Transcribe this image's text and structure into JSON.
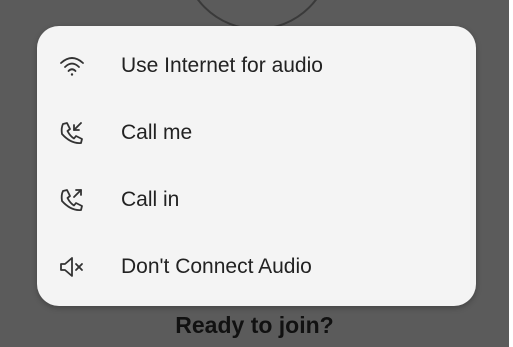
{
  "audio_menu": {
    "options": [
      {
        "label": "Use Internet for audio",
        "icon": "wifi-icon"
      },
      {
        "label": "Call me",
        "icon": "phone-incoming-icon"
      },
      {
        "label": "Call in",
        "icon": "phone-outgoing-icon"
      },
      {
        "label": "Don't Connect Audio",
        "icon": "speaker-muted-icon"
      }
    ]
  },
  "footer": {
    "ready_text": "Ready to join?"
  },
  "colors": {
    "backdrop": "#5b5b5b",
    "sheet": "#f4f4f4",
    "text": "#222222"
  }
}
